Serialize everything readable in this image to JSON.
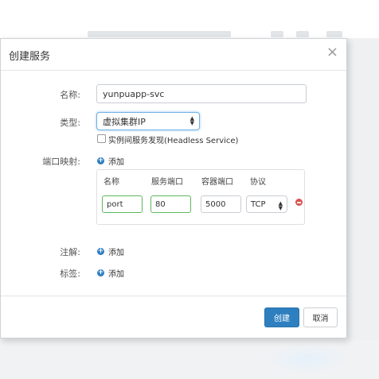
{
  "dialog": {
    "title": "创建服务",
    "close": "×"
  },
  "form": {
    "name_label": "名称:",
    "name_value": "yunpuapp-svc",
    "type_label": "类型:",
    "type_value": "虚拟集群IP",
    "headless_label": "实例间服务发现(Headless Service)",
    "headless_checked": false,
    "port_map_label": "端口映射:",
    "annotation_label": "注解:",
    "tags_label": "标签:",
    "add_label": "添加"
  },
  "port_table": {
    "headers": [
      "名称",
      "服务端口",
      "容器端口",
      "协议"
    ],
    "row": {
      "name": "port",
      "service_port": "80",
      "container_port": "5000",
      "protocol": "TCP"
    }
  },
  "footer": {
    "create_label": "创建",
    "cancel_label": "取消"
  },
  "colors": {
    "primary": "#2e7fbf",
    "valid_border": "#5cb85c",
    "danger": "#d9534f"
  }
}
